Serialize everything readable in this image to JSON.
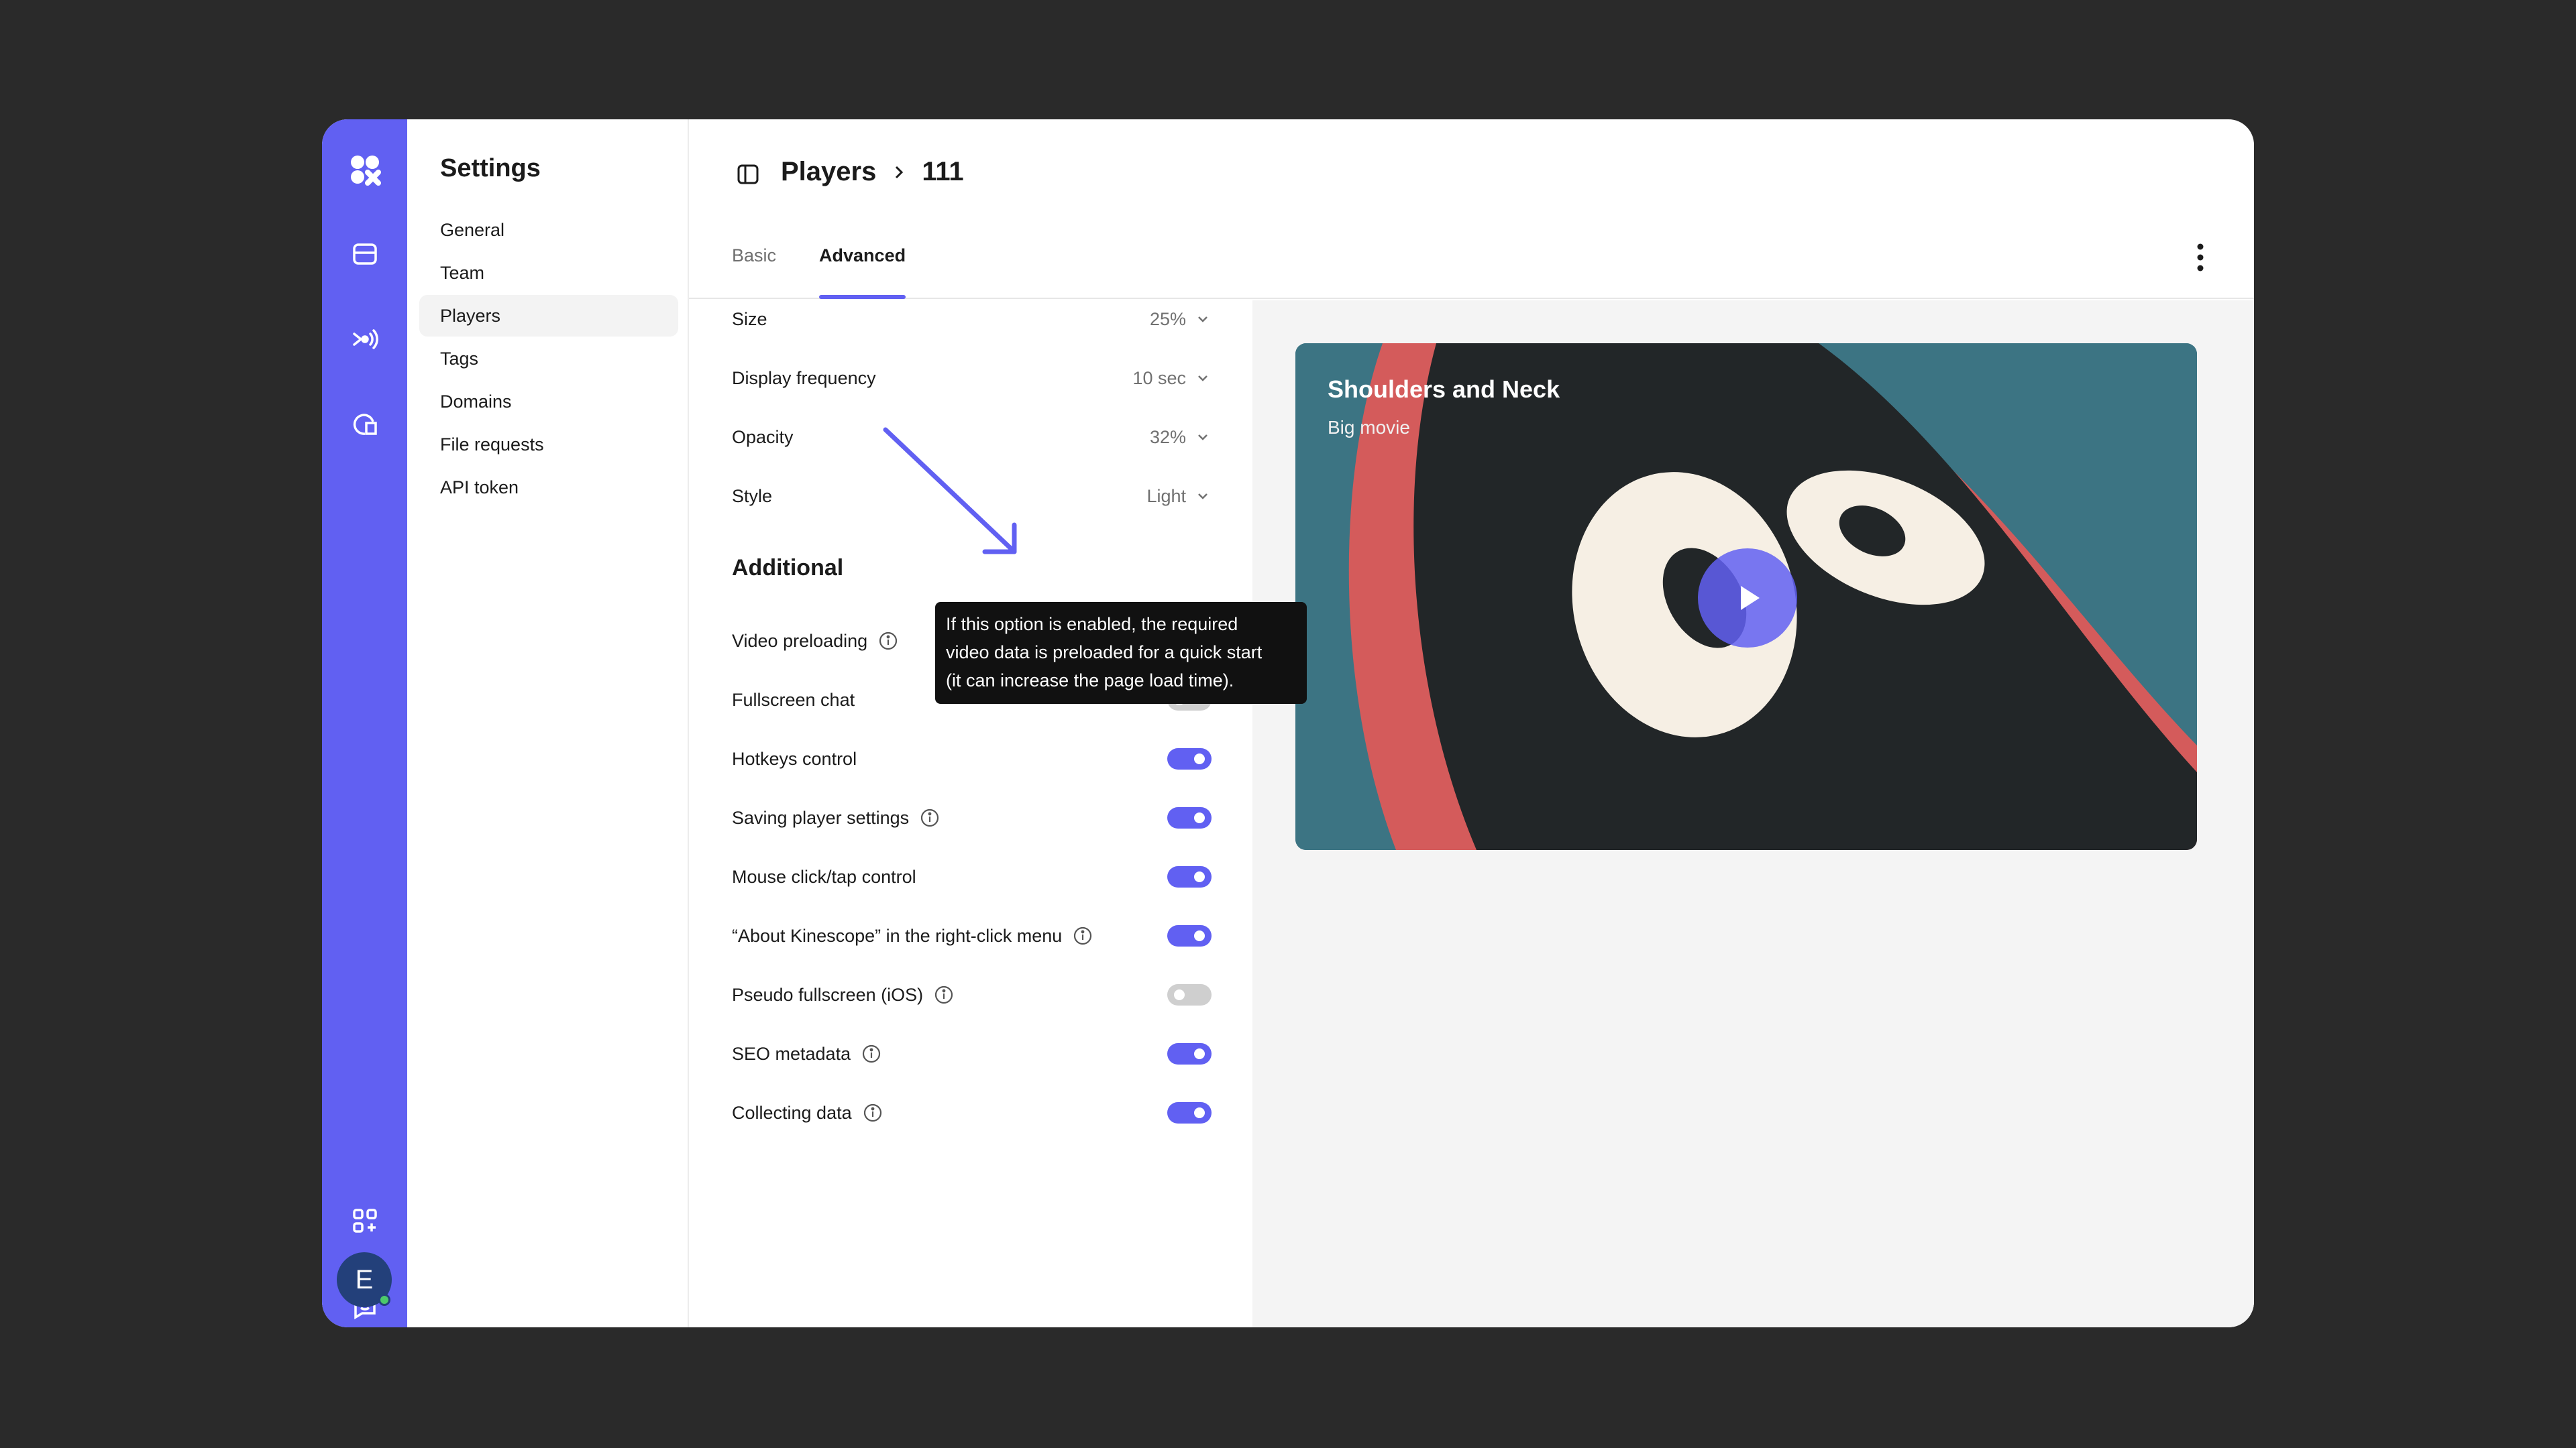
{
  "sidebar": {
    "icons": [
      "logo-icon",
      "folder-icon",
      "broadcast-icon",
      "analytics-icon",
      "apps-add-icon",
      "chat-icon"
    ],
    "avatar_initial": "E"
  },
  "settings": {
    "title": "Settings",
    "items": [
      {
        "label": "General"
      },
      {
        "label": "Team"
      },
      {
        "label": "Players",
        "active": true
      },
      {
        "label": "Tags"
      },
      {
        "label": "Domains"
      },
      {
        "label": "File requests"
      },
      {
        "label": "API token"
      }
    ]
  },
  "header": {
    "breadcrumb": [
      "Players",
      "111"
    ],
    "tabs": [
      {
        "label": "Basic"
      },
      {
        "label": "Advanced",
        "active": true
      }
    ]
  },
  "options": {
    "selects": [
      {
        "label": "Size",
        "value": "25%"
      },
      {
        "label": "Display frequency",
        "value": "10 sec"
      },
      {
        "label": "Opacity",
        "value": "32%"
      },
      {
        "label": "Style",
        "value": "Light"
      }
    ],
    "additional_title": "Additional",
    "toggles": [
      {
        "label": "Video preloading",
        "info": true,
        "on": true
      },
      {
        "label": "Fullscreen chat",
        "info": false,
        "on": false
      },
      {
        "label": "Hotkeys control",
        "info": false,
        "on": true
      },
      {
        "label": "Saving player settings",
        "info": true,
        "on": true
      },
      {
        "label": "Mouse click/tap control",
        "info": false,
        "on": true
      },
      {
        "label": "“About Kinescope” in the right-click menu",
        "info": true,
        "on": true
      },
      {
        "label": "Pseudo fullscreen (iOS)",
        "info": true,
        "on": false
      },
      {
        "label": "SEO metadata",
        "info": true,
        "on": true
      },
      {
        "label": "Collecting data",
        "info": true,
        "on": true
      }
    ]
  },
  "tooltip": {
    "lines": [
      "If this option is enabled, the required",
      "video data is preloaded for a quick start",
      "(it can increase the page load time)."
    ]
  },
  "preview": {
    "title": "Shoulders and Neck",
    "subtitle": "Big movie"
  },
  "colors": {
    "accent": "#6160f2",
    "background": "#2a2a2a",
    "video_teal": "#3c7483",
    "video_red": "#d45b5b"
  }
}
